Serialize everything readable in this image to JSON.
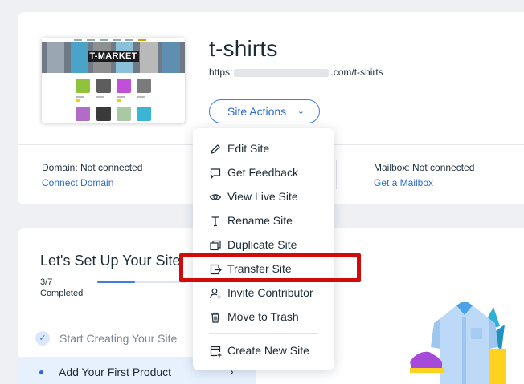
{
  "site": {
    "title": "t-shirts",
    "url_prefix": "https:",
    "url_suffix": ".com/t-shirts",
    "thumbnail_brand": "T-MARKET",
    "actions_button": "Site Actions"
  },
  "site_info": {
    "domain_status": "Domain: Not connected",
    "domain_link": "Connect Domain",
    "mailbox_status": "Mailbox: Not connected",
    "mailbox_link": "Get a Mailbox"
  },
  "setup": {
    "title": "Let's Set Up Your Site",
    "progress_count": "3/7",
    "progress_label": "Completed",
    "progress_fraction": 0.43,
    "steps": [
      {
        "label": "Start Creating Your Site",
        "done": true
      },
      {
        "label": "Add Your First Product",
        "done": false
      }
    ]
  },
  "site_actions_menu": {
    "items": [
      {
        "label": "Edit Site",
        "icon": "pencil-icon"
      },
      {
        "label": "Get Feedback",
        "icon": "speech-bubble-icon"
      },
      {
        "label": "View Live Site",
        "icon": "eye-icon"
      },
      {
        "label": "Rename Site",
        "icon": "text-cursor-icon"
      },
      {
        "label": "Duplicate Site",
        "icon": "duplicate-icon"
      },
      {
        "label": "Transfer Site",
        "icon": "transfer-icon"
      },
      {
        "label": "Invite Contributor",
        "icon": "add-person-icon"
      },
      {
        "label": "Move to Trash",
        "icon": "trash-icon"
      },
      {
        "label": "Create New Site",
        "icon": "new-site-icon"
      }
    ],
    "highlighted_item": "Transfer Site"
  },
  "colors": {
    "accent": "#3b7de9",
    "highlight_box": "#d20a0a",
    "page_background": "#eef0f4"
  }
}
